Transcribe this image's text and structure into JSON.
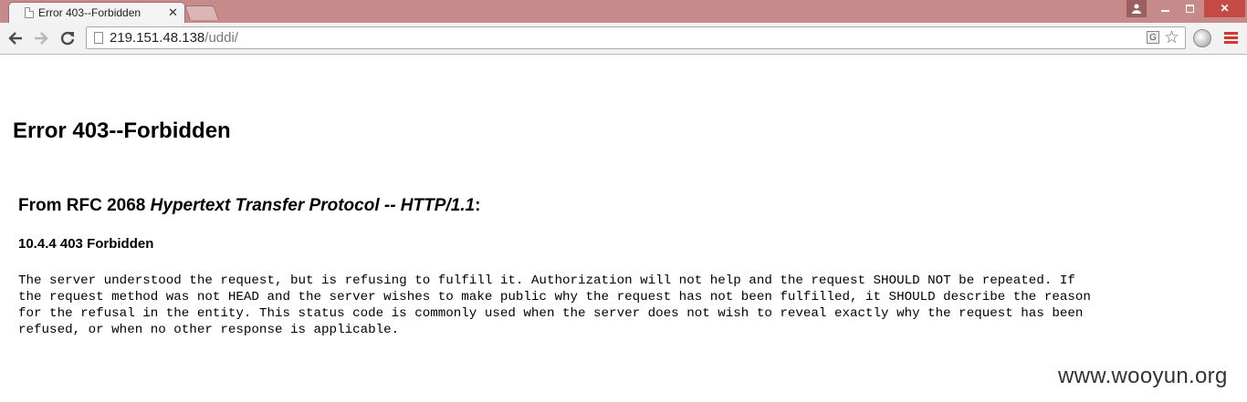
{
  "browser": {
    "tab": {
      "title": "Error 403--Forbidden",
      "close_label": "✕"
    },
    "window_controls": {
      "user": "👤",
      "close": "✕"
    },
    "url": {
      "host": "219.151.48.138",
      "path": "/uddi/"
    },
    "icons": [
      "back-arrow-icon",
      "forward-arrow-icon",
      "reload-icon",
      "page-icon",
      "translate-icon",
      "star-icon",
      "extension-globe-icon",
      "menu-icon"
    ]
  },
  "page": {
    "title": "Error 403--Forbidden",
    "rfc_prefix": "From RFC 2068 ",
    "rfc_italic": "Hypertext Transfer Protocol -- HTTP/1.1",
    "rfc_suffix": ":",
    "section": "10.4.4 403 Forbidden",
    "body": "The server understood the request, but is refusing to fulfill it. Authorization will not help and the request SHOULD NOT be repeated. If\nthe request method was not HEAD and the server wishes to make public why the request has not been fulfilled, it SHOULD describe the reason\nfor the refusal in the entity. This status code is commonly used when the server does not wish to reveal exactly why the request has been\nrefused, or when no other response is applicable."
  },
  "watermark": "www.wooyun.org",
  "colors": {
    "titlebar": "#c78a8a",
    "close_button": "#c44a43",
    "menu_icon": "#d2362d"
  }
}
